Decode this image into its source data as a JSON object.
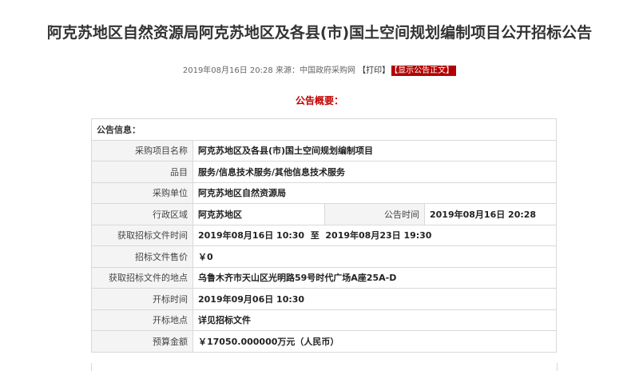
{
  "title": "阿克苏地区自然资源局阿克苏地区及各县(市)国土空间规划编制项目公开招标公告",
  "meta": {
    "date": "2019年08月16日 20:28",
    "source_label": "来源：",
    "source": "中国政府采购网",
    "print": "【打印】",
    "show_original": "【显示公告正文】"
  },
  "summary_title": "公告概要：",
  "section_title": "公告信息：",
  "rows": {
    "project_name": {
      "label": "采购项目名称",
      "value": "阿克苏地区及各县(市)国土空间规划编制项目"
    },
    "category": {
      "label": "品目",
      "value": "服务/信息技术服务/其他信息技术服务"
    },
    "purchaser": {
      "label": "采购单位",
      "value": "阿克苏地区自然资源局"
    },
    "region": {
      "label": "行政区域",
      "value": "阿克苏地区"
    },
    "announce_time": {
      "label": "公告时间",
      "value": "2019年08月16日 20:28"
    },
    "doc_time": {
      "label": "获取招标文件时间",
      "value": "2019年08月16日 10:30  至  2019年08月23日 19:30"
    },
    "doc_price": {
      "label": "招标文件售价",
      "value": "￥0"
    },
    "doc_place": {
      "label": "获取招标文件的地点",
      "value": "乌鲁木齐市天山区光明路59号时代广场A座25A-D"
    },
    "open_time": {
      "label": "开标时间",
      "value": "2019年09月06日 10:30"
    },
    "open_place": {
      "label": "开标地点",
      "value": "详见招标文件"
    },
    "budget": {
      "label": "预算金额",
      "value": "￥17050.000000万元（人民币）"
    }
  }
}
